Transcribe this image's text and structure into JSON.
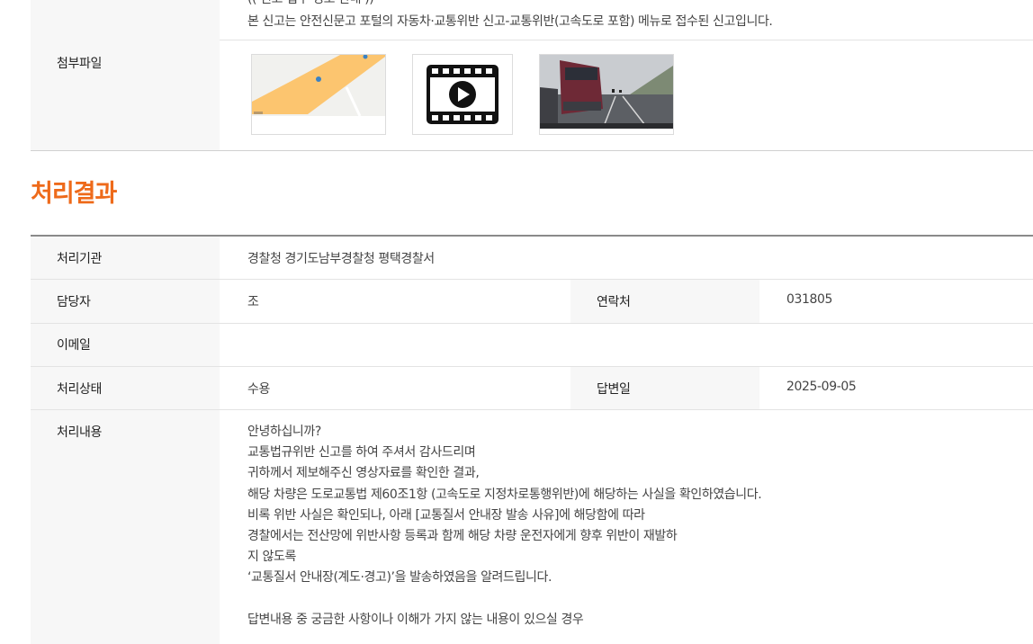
{
  "report": {
    "notice_partial": "(( 신고 접수 경로 안내 ))",
    "notice": "본 신고는 안전신문고 포털의 자동차·교통위반 신고-교통위반(고속도로 포함) 메뉴로 접수된 신고입니다."
  },
  "attachments": {
    "label": "첨부파일",
    "items": [
      {
        "type": "map",
        "icon": "map-thumbnail"
      },
      {
        "type": "video",
        "icon": "video-play-icon"
      },
      {
        "type": "image",
        "icon": "dashcam-photo"
      }
    ]
  },
  "result": {
    "title": "처리결과",
    "agency_label": "처리기관",
    "agency": "경찰청 경기도남부경찰청 평택경찰서",
    "manager_label": "담당자",
    "manager": "조",
    "contact_label": "연락처",
    "contact": "031805",
    "email_label": "이메일",
    "email": "",
    "status_label": "처리상태",
    "status": "수용",
    "answer_date_label": "답변일",
    "answer_date": "2025-09-05",
    "content_label": "처리내용",
    "content": "안녕하십니까?\n교통법규위반 신고를 하여 주셔서 감사드리며\n귀하께서 제보해주신 영상자료를 확인한 결과,\n해당 차량은 도로교통법 제60조1항 (고속도로 지정차로통행위반)에 해당하는 사실을 확인하였습니다.\n비록 위반 사실은 확인되나, 아래 [교통질서 안내장 발송 사유]에 해당함에 따라\n경찰에서는 전산망에 위반사항 등록과 함께 해당 차량 운전자에게 향후 위반이 재발하\n지 않도록\n‘교통질서 안내장(계도·경고)’을 발송하였음을 알려드립니다.\n\n답변내용 중 궁금한 사항이나 이해가 가지 않는 내용이 있으실 경우"
  },
  "colors": {
    "accent": "#ee6a1a",
    "label_bg": "#f7f7f7",
    "map_road": "#fcc56f"
  }
}
